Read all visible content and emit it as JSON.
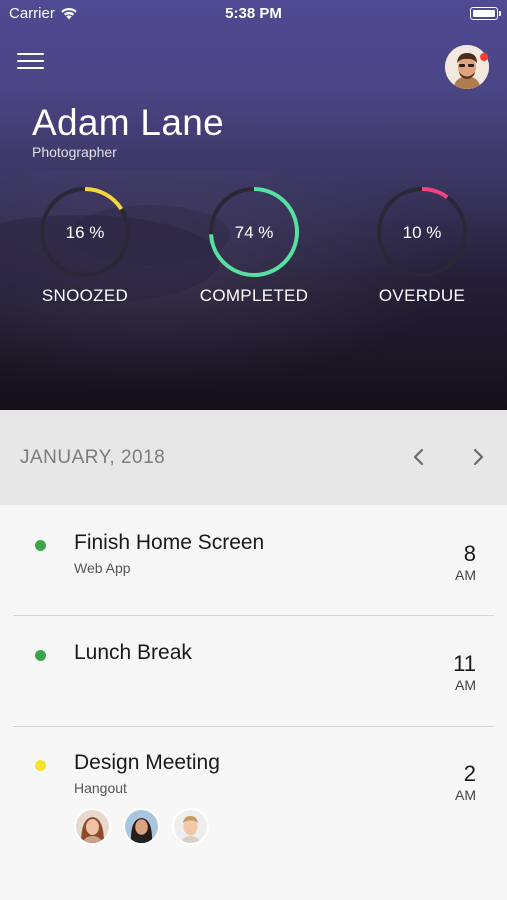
{
  "status_bar": {
    "carrier": "Carrier",
    "time": "5:38 PM"
  },
  "profile": {
    "name": "Adam Lane",
    "role": "Photographer"
  },
  "stats": [
    {
      "id": "snoozed",
      "percent_text": "16 %",
      "percent": 16,
      "label": "SNOOZED",
      "color": "#f5d63d"
    },
    {
      "id": "completed",
      "percent_text": "74 %",
      "percent": 74,
      "label": "COMPLETED",
      "color": "#57e0a1"
    },
    {
      "id": "overdue",
      "percent_text": "10 %",
      "percent": 10,
      "label": "OVERDUE",
      "color": "#f0437f"
    }
  ],
  "calendar": {
    "month": "JANUARY, 2018"
  },
  "events": [
    {
      "title": "Finish Home Screen",
      "subtitle": "Web App",
      "time": "8",
      "ampm": "AM",
      "dot_color": "#3fa34d"
    },
    {
      "title": "Lunch Break",
      "subtitle": "",
      "time": "11",
      "ampm": "AM",
      "dot_color": "#3fa34d"
    },
    {
      "title": "Design Meeting",
      "subtitle": "Hangout",
      "time": "2",
      "ampm": "AM",
      "dot_color": "#f7e233"
    }
  ],
  "colors": {
    "ring_track": "#2b2735",
    "notification_dot": "#ff3b30"
  }
}
